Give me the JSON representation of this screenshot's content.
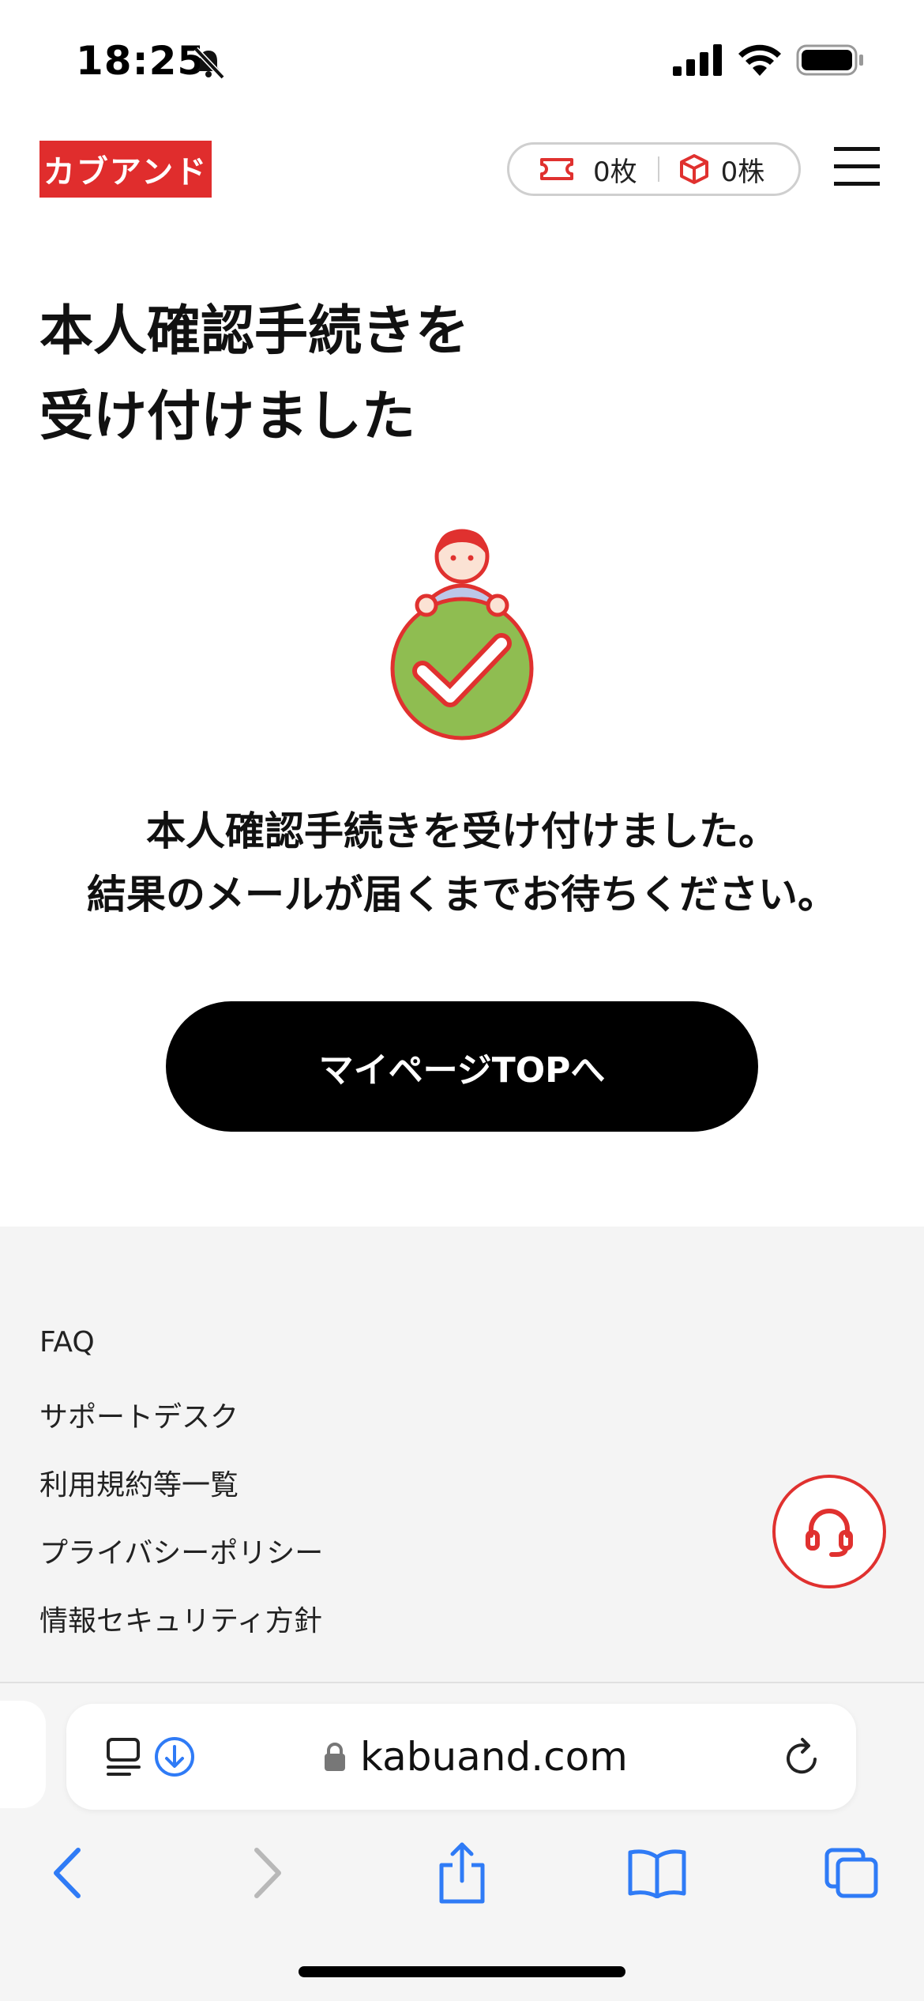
{
  "status_bar": {
    "time": "18:25"
  },
  "header": {
    "logo_text": "カブアンド",
    "tickets": "0枚",
    "shares": "0株"
  },
  "main": {
    "title_line1": "本人確認手続きを",
    "title_line2": "受け付けました",
    "message_line1": "本人確認手続きを受け付けました。",
    "message_line2": "結果のメールが届くまでお待ちください。",
    "mypage_button": "マイページTOPへ"
  },
  "footer": {
    "links": [
      "FAQ",
      "サポートデスク",
      "利用規約等一覧",
      "プライバシーポリシー",
      "情報セキュリティ方針"
    ]
  },
  "browser": {
    "url": "kabuand.com"
  },
  "colors": {
    "brand_red": "#e02d2d",
    "check_green": "#8fbd51",
    "button_black": "#000000",
    "footer_bg": "#f4f4f4",
    "safari_blue": "#2f7bf6"
  }
}
